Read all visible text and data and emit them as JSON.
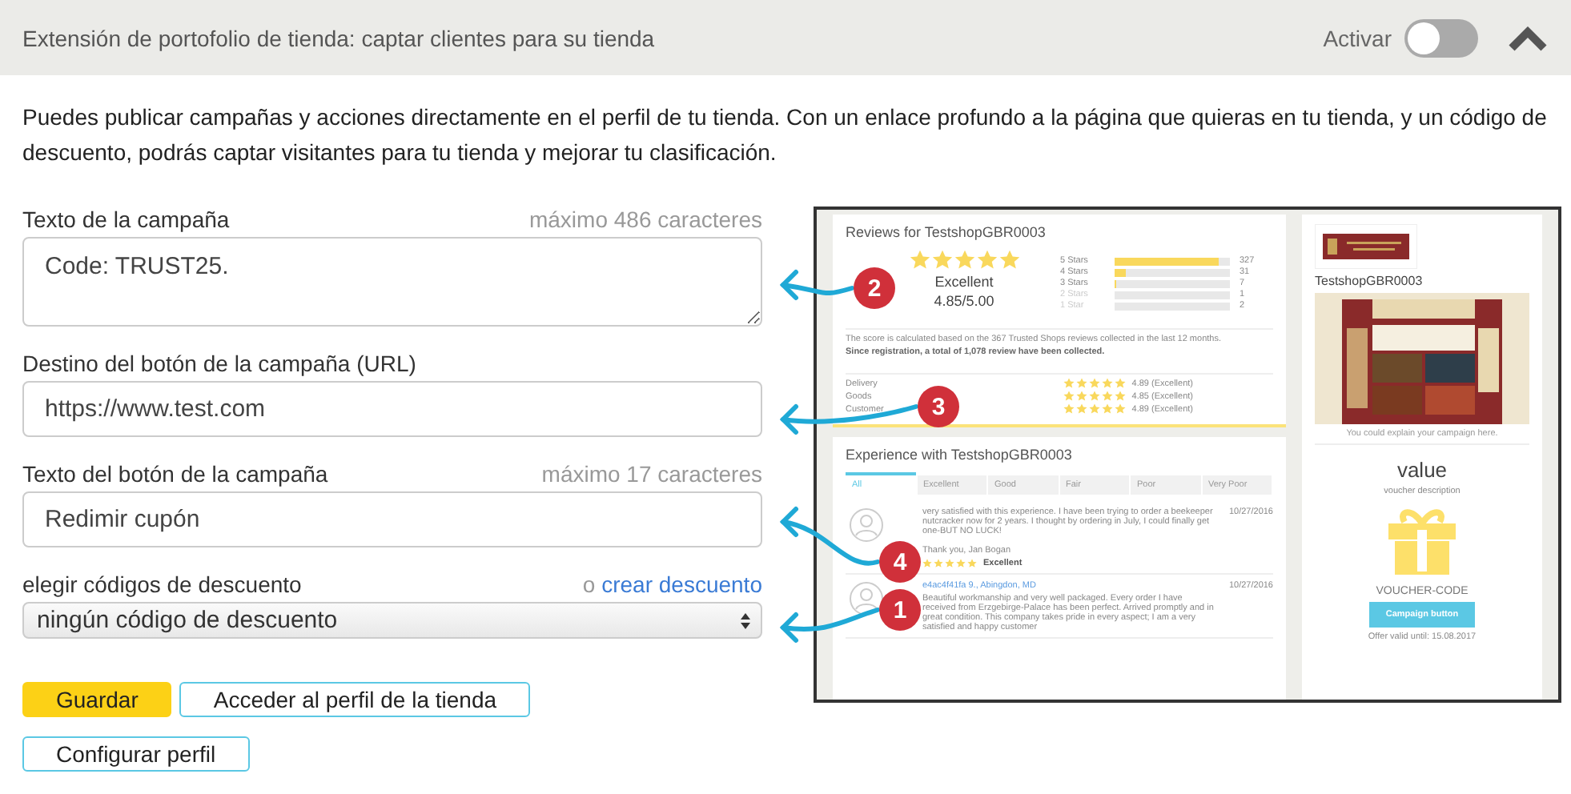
{
  "header": {
    "title": "Extensión de portofolio de tienda: captar clientes para su tienda",
    "toggle_label": "Activar",
    "on": false,
    "expanded": true
  },
  "description": "Puedes publicar campañas y acciones directamente en el perfil de tu tienda. Con un enlace profundo a la página que quieras en tu tienda, y un código de descuento, podrás captar visitantes para tu tienda y mejorar tu clasificación.",
  "form": {
    "fields": [
      {
        "kind": "textarea",
        "label": "Texto de la campaña",
        "hint": "máximo 486 caracteres",
        "value": "Code: TRUST25."
      },
      {
        "kind": "input",
        "label": "Destino del botón de la campaña (URL)",
        "value": "https://www.test.com"
      },
      {
        "kind": "input",
        "label": "Texto del botón de la campaña",
        "hint": "máximo 17 caracteres",
        "value": "Redimir cupón"
      },
      {
        "kind": "select",
        "label": "elegir códigos de descuento",
        "link_prefix": "o",
        "link": "crear descuento",
        "value": "ningún código de descuento"
      }
    ],
    "buttons": [
      {
        "label": "Guardar",
        "kind": "primary"
      },
      {
        "label": "Acceder al perfil de la tienda",
        "kind": "outline"
      },
      {
        "label": "Configurar perfil",
        "kind": "outline"
      }
    ]
  },
  "callouts": [
    "2",
    "3",
    "4",
    "1"
  ],
  "preview": {
    "reviews": {
      "title": "Reviews for TestshopGBR0003",
      "stars": 5,
      "rating": "Excellent",
      "score": "4.85/5.00",
      "distribution": [
        {
          "label": "5 Stars",
          "level": 0.9,
          "count": "327"
        },
        {
          "label": "4 Stars",
          "level": 0.1,
          "count": "31"
        },
        {
          "label": "3 Stars",
          "level": 0.02,
          "count": "7"
        },
        {
          "label": "2 Stars",
          "level": 0,
          "count": "1"
        },
        {
          "label": "1 Star",
          "level": 0,
          "count": "2"
        }
      ],
      "note": "The score is calculated based on the 367 Trusted Shops reviews collected in the last 12 months.",
      "note_2": "Since registration, a total of 1,078 review have been collected.",
      "criteria": [
        {
          "label": "Delivery",
          "stars": 5,
          "score": "4.89 (Excellent)"
        },
        {
          "label": "Goods",
          "stars": 5,
          "score": "4.85 (Excellent)"
        },
        {
          "label": "Customer",
          "stars": 5,
          "score": "4.89 (Excellent)"
        }
      ]
    },
    "experience": {
      "title": "Experience with TestshopGBR0003",
      "tabs": [
        {
          "label": "All",
          "selected": true
        },
        {
          "label": "Excellent",
          "selected": false
        },
        {
          "label": "Good",
          "selected": false
        },
        {
          "label": "Fair",
          "selected": false
        },
        {
          "label": "Poor",
          "selected": false
        },
        {
          "label": "Very Poor",
          "selected": false
        }
      ],
      "reviews": [
        {
          "date": "10/27/2016",
          "text": "very satisfied with this experience. I have been trying to order a beekeeper nutcracker now for 2 years. I thought by ordering in July, I could finally get one-BUT NO LUCK!",
          "signoff": "Thank you, Jan Bogan",
          "stars": 5,
          "rating": "Excellent"
        },
        {
          "author": "e4ac4f41fa 9., Abingdon, MD",
          "date": "10/27/2016",
          "text": "Beautiful workmanship and very well packaged. Every order I have received from Erzgebirge-Palace has been perfect. Arrived promptly and in great condition. This company takes pride in every aspect; I am a very satisfied and happy customer"
        }
      ]
    },
    "sidebar": {
      "shop_name": "TestshopGBR0003",
      "caption": "You could explain your campaign here.",
      "value": "value",
      "voucher_description": "voucher description",
      "voucher_code": "VOUCHER-CODE",
      "button": "Campaign button",
      "valid_until": "Offer valid until: 15.08.2017"
    }
  }
}
